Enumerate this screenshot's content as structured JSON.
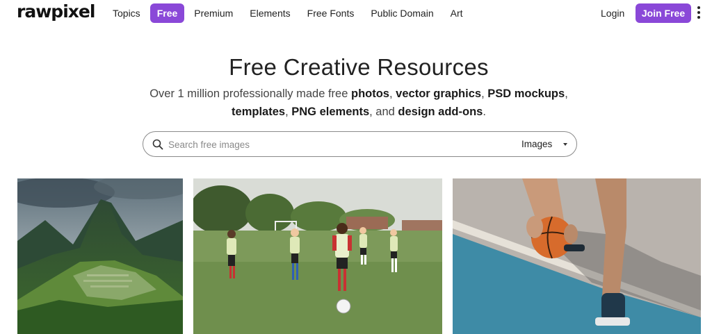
{
  "brand": {
    "logo": "rawpixel",
    "accent": "#8a48d8"
  },
  "nav": {
    "links": [
      "Topics",
      "Free",
      "Premium",
      "Elements",
      "Free Fonts",
      "Public Domain",
      "Art"
    ],
    "active": "Free",
    "login": "Login",
    "join": "Join Free"
  },
  "hero": {
    "title": "Free Creative Resources",
    "line1": [
      "Over 1 million professionally made free ",
      "photos",
      ", ",
      "vector graphics",
      ", ",
      "PSD mockups",
      ","
    ],
    "line2": [
      "templates",
      ", ",
      "PNG elements",
      ", and ",
      "design add-ons",
      "."
    ]
  },
  "search": {
    "placeholder": "Search free images",
    "type": "Images"
  },
  "images": [
    {
      "subject": "mountain-ruins-photo"
    },
    {
      "subject": "kids-soccer-photo"
    },
    {
      "subject": "basketball-court-photo"
    }
  ]
}
